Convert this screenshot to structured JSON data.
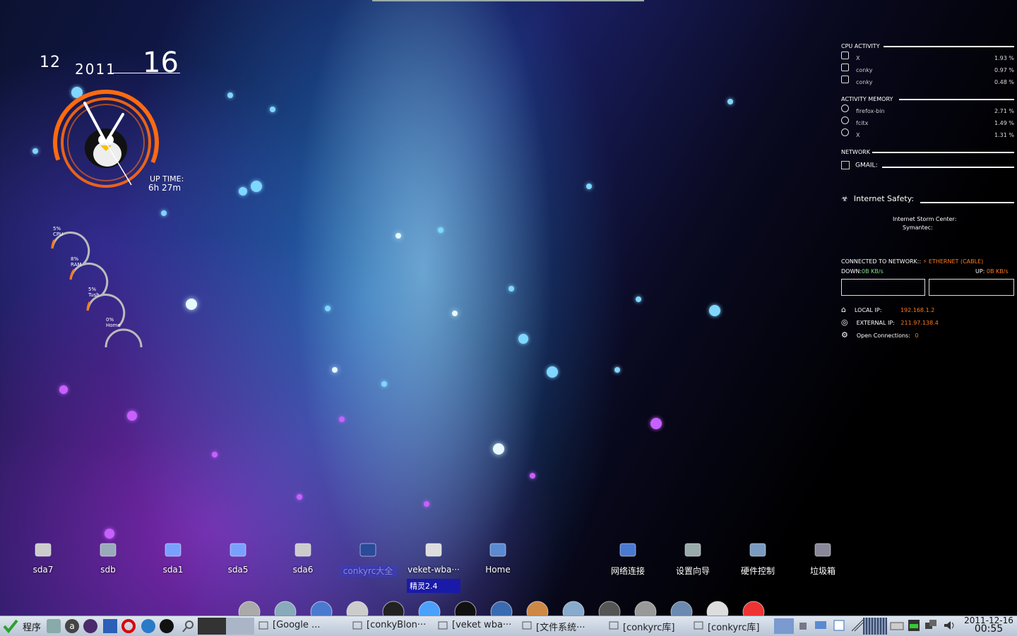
{
  "clock": {
    "month": "12",
    "year": "2011",
    "day": "16",
    "uptime_label": "UP TIME:",
    "uptime_value": "6h 27m"
  },
  "rings": [
    {
      "pct": "5%",
      "name": "CPU"
    },
    {
      "pct": "8%",
      "name": "RAM"
    },
    {
      "pct": "5%",
      "name": "Tush"
    },
    {
      "pct": "0%",
      "name": "Home"
    }
  ],
  "conky": {
    "cpu_title": "CPU ACTIVITY",
    "cpu": [
      {
        "name": "X",
        "value": "1.93 %"
      },
      {
        "name": "conky",
        "value": "0.97 %"
      },
      {
        "name": "conky",
        "value": "0.48 %"
      }
    ],
    "mem_title": "ACTIVITY MEMORY",
    "mem": [
      {
        "name": "firefox-bin",
        "value": "2.71 %"
      },
      {
        "name": "fcitx",
        "value": "1.49 %"
      },
      {
        "name": "X",
        "value": "1.31 %"
      }
    ],
    "network_title": "NETWORK",
    "gmail_label": "GMAIL:",
    "safety_label": "Internet Safety:",
    "storm_label": "Internet Storm Center:",
    "symantec_label": "Symantec:",
    "connected_label": "CONNECTED TO NETWORK::",
    "connection_type": "ETHERNET (CABLE)",
    "down_label": "DOWN:",
    "down_value": "0B KB/s",
    "up_label": "UP:",
    "up_value": "0B KB/s",
    "local_ip_label": "LOCAL IP:",
    "local_ip": "192.168.1.2",
    "external_ip_label": "EXTERNAL IP:",
    "external_ip": "211.97.138.4",
    "open_conn_label": "Open Connections:",
    "open_conn_value": "0"
  },
  "desktop_icons": [
    {
      "label": "sda7",
      "icon": "drive-icon"
    },
    {
      "label": "sdb",
      "icon": "usb-disk-icon"
    },
    {
      "label": "sda1",
      "icon": "drive-red-icon"
    },
    {
      "label": "sda5",
      "icon": "drive-green-icon"
    },
    {
      "label": "sda6",
      "icon": "drive-icon"
    },
    {
      "label": "conkyrc大全",
      "icon": "folder-window-icon"
    },
    {
      "label": "veket-wba···",
      "icon": "document-window-icon"
    },
    {
      "label": "Home",
      "icon": "home-icon"
    },
    {
      "label": "网络连接",
      "icon": "network-icon"
    },
    {
      "label": "设置向导",
      "icon": "setup-wizard-icon"
    },
    {
      "label": "硬件控制",
      "icon": "hardware-control-icon"
    },
    {
      "label": "垃圾箱",
      "icon": "trash-icon"
    }
  ],
  "tooltip": "精灵2.4",
  "taskbar": {
    "start_label": "程序",
    "tasks": [
      {
        "label": "[Google ...",
        "icon": "firefox-icon"
      },
      {
        "label": "[conkyBlon···",
        "icon": "folder-icon"
      },
      {
        "label": "[veket wba···",
        "icon": "gear-icon"
      },
      {
        "label": "[文件系统···",
        "icon": "drive-icon"
      },
      {
        "label": "[conkyrc库]",
        "icon": "window-icon"
      },
      {
        "label": "[conkyrc库]",
        "icon": "window-icon"
      }
    ],
    "date": "2011-12-16",
    "time": "00:55"
  },
  "colors": {
    "accent_orange": "#ff7a1a",
    "down_green": "#7fe07f",
    "taskbar_bg": "#cdd6e3"
  }
}
